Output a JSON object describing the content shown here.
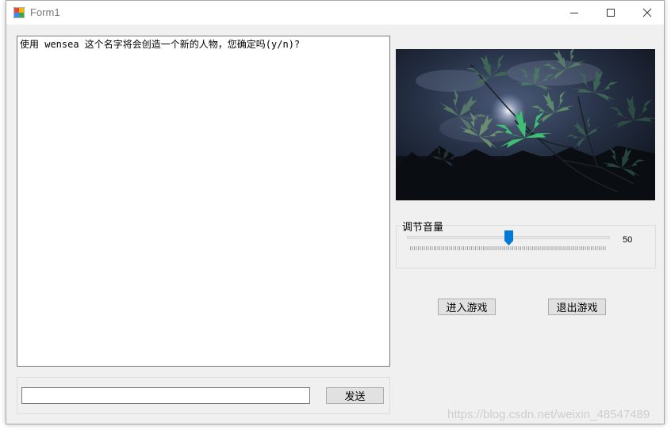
{
  "window": {
    "title": "Form1"
  },
  "chat": {
    "log": "使用 wensea 这个名字将会创造一个新的人物，您确定吗(y/n)?"
  },
  "input": {
    "value": "",
    "send_label": "发送"
  },
  "volume": {
    "label": "调节音量",
    "value": "50",
    "level": 0.5
  },
  "buttons": {
    "enter_label": "进入游戏",
    "exit_label": "退出游戏"
  },
  "watermark": "https://blog.csdn.net/weixin_48547489",
  "colors": {
    "slider_thumb": "#0078d7",
    "window_bg": "#f0f0f0"
  }
}
